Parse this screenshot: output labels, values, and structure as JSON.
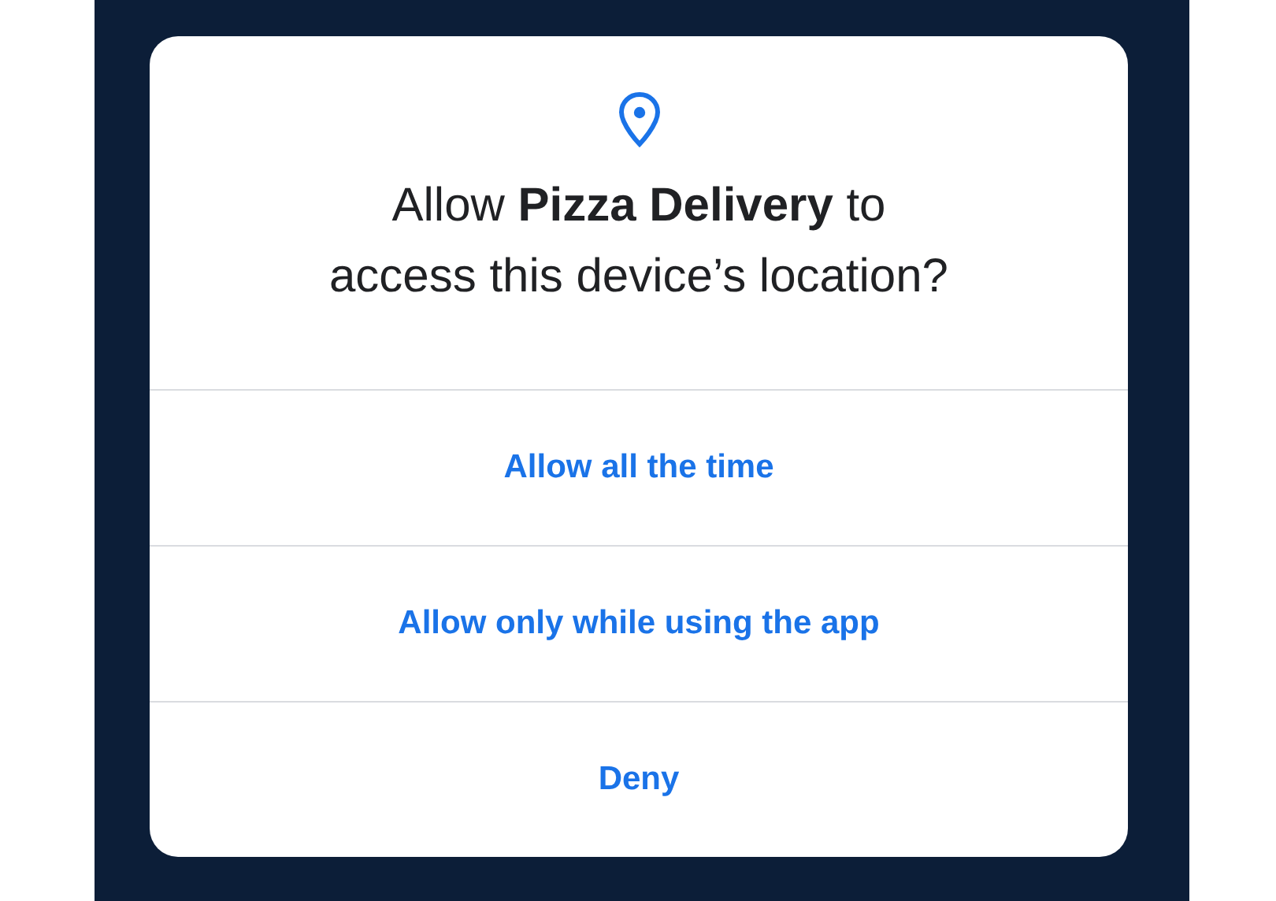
{
  "dialog": {
    "title": "Allow **Pizza Delivery** to\naccess this device’s location?",
    "buttons": [
      {
        "label": "Allow all the time"
      },
      {
        "label": "Allow only while using the app"
      },
      {
        "label": "Deny"
      }
    ]
  }
}
